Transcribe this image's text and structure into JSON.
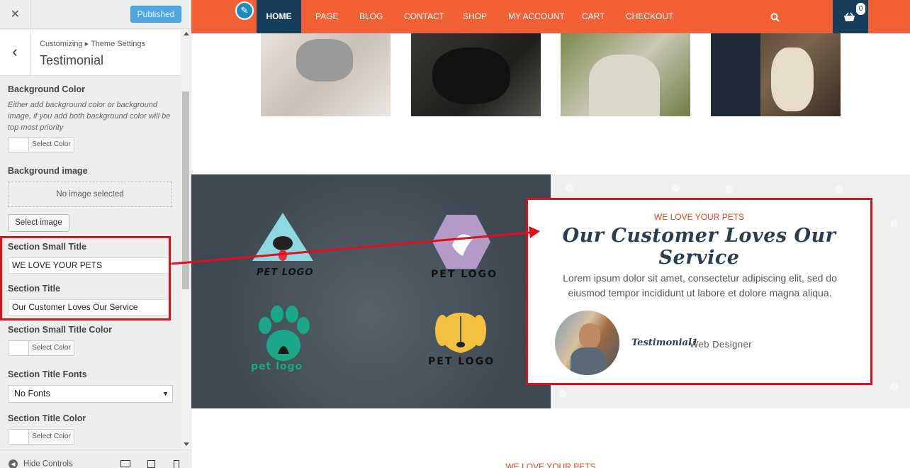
{
  "sidebar": {
    "close_icon": "close-icon",
    "publish_label": "Published",
    "breadcrumb": "Customizing ▸ Theme Settings",
    "section_title": "Testimonial",
    "background_color": {
      "label": "Background Color",
      "description": "Either add background color or background image, if you add both background color will be top most priority",
      "button": "Select Color"
    },
    "background_image": {
      "label": "Background image",
      "placeholder": "No image selected",
      "button": "Select image"
    },
    "small_title": {
      "label": "Section Small Title",
      "value": "WE LOVE YOUR PETS"
    },
    "title": {
      "label": "Section Title",
      "value": "Our Customer Loves Our Service"
    },
    "small_title_color": {
      "label": "Section Small Title Color",
      "button": "Select Color"
    },
    "title_fonts": {
      "label": "Section Title Fonts",
      "value": "No Fonts"
    },
    "title_color": {
      "label": "Section Title Color",
      "button": "Select Color"
    },
    "footer": {
      "hide_controls": "Hide Controls"
    }
  },
  "navbar": {
    "items": [
      "HOME",
      "PAGE",
      "BLOG",
      "CONTACT",
      "SHOP",
      "MY ACCOUNT",
      "CART",
      "CHECKOUT"
    ],
    "active": "HOME",
    "cart_count": "0",
    "accent": "#f26035",
    "dark": "#163d5c"
  },
  "logos": [
    {
      "text": "PET LOGO",
      "icon": "triangle-dog-logo-icon"
    },
    {
      "text": "PET LOGO",
      "icon": "hexagon-pet-logo-icon"
    },
    {
      "text": "pet logo",
      "icon": "paw-cat-logo-icon"
    },
    {
      "text": "PET LOGO",
      "icon": "dog-face-logo-icon"
    }
  ],
  "testimonial": {
    "small_title": "WE LOVE YOUR PETS",
    "title": "Our Customer Loves Our Service",
    "text": "Lorem ipsum dolor sit amet, consectetur adipiscing elit, sed do eiusmod tempor incididunt ut labore et dolore magna aliqua.",
    "name": "Testimonial1",
    "role": "Web Designer"
  },
  "next_section_small_title": "WE LOVE YOUR PETS"
}
